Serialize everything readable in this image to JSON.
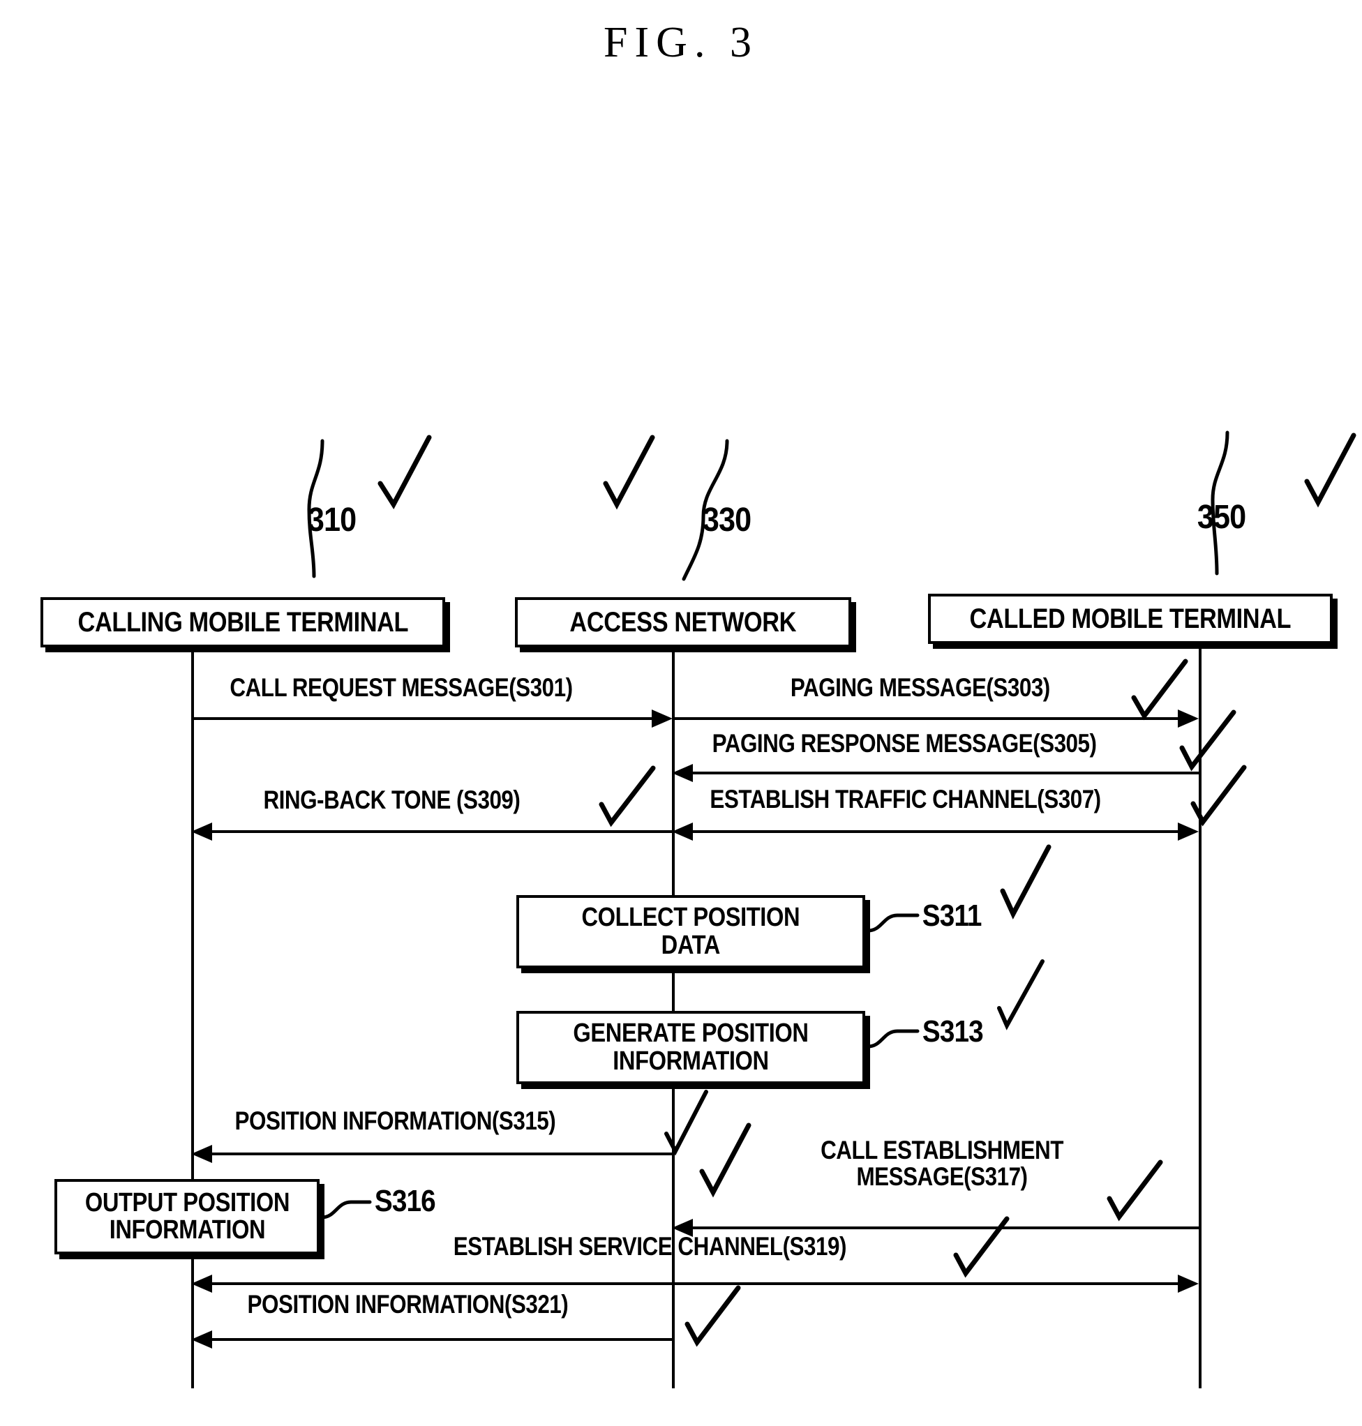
{
  "figure": {
    "title": "FIG. 3",
    "type": "patent-sequence-diagram"
  },
  "entities": [
    {
      "id": "calling",
      "label": "CALLING MOBILE TERMINAL",
      "ref": "310"
    },
    {
      "id": "access",
      "label": "ACCESS NETWORK",
      "ref": "330"
    },
    {
      "id": "called",
      "label": "CALLED MOBILE TERMINAL",
      "ref": "350"
    }
  ],
  "messages": [
    {
      "step": "S301",
      "label": "CALL REQUEST MESSAGE(S301)",
      "from": "calling",
      "to": "access",
      "direction": "right"
    },
    {
      "step": "S303",
      "label": "PAGING MESSAGE(S303)",
      "from": "access",
      "to": "called",
      "direction": "right"
    },
    {
      "step": "S305",
      "label": "PAGING RESPONSE MESSAGE(S305)",
      "from": "called",
      "to": "access",
      "direction": "left"
    },
    {
      "step": "S307",
      "label": "ESTABLISH TRAFFIC CHANNEL(S307)",
      "from": "access",
      "to": "called",
      "direction": "both"
    },
    {
      "step": "S309",
      "label": "RING-BACK TONE (S309)",
      "from": "access",
      "to": "calling",
      "direction": "left"
    },
    {
      "step": "S315",
      "label": "POSITION INFORMATION(S315)",
      "from": "access",
      "to": "calling",
      "direction": "left"
    },
    {
      "step": "S317",
      "label": "CALL ESTABLISHMENT MESSAGE(S317)",
      "from": "called",
      "to": "access",
      "direction": "left"
    },
    {
      "step": "S319",
      "label": "ESTABLISH SERVICE CHANNEL(S319)",
      "from": "calling",
      "to": "called",
      "direction": "both"
    },
    {
      "step": "S321",
      "label": "POSITION INFORMATION(S321)",
      "from": "access",
      "to": "calling",
      "direction": "left"
    }
  ],
  "message_labels": {
    "s301": "CALL REQUEST MESSAGE(S301)",
    "s303": "PAGING MESSAGE(S303)",
    "s305": "PAGING RESPONSE MESSAGE(S305)",
    "s307": "ESTABLISH TRAFFIC CHANNEL(S307)",
    "s309": "RING-BACK TONE (S309)",
    "s315": "POSITION INFORMATION(S315)",
    "s317_line1": "CALL ESTABLISHMENT",
    "s317_line2": "MESSAGE(S317)",
    "s319": "ESTABLISH SERVICE CHANNEL(S319)",
    "s321": "POSITION INFORMATION(S321)"
  },
  "processes": [
    {
      "id": "collect",
      "line1": "COLLECT POSITION",
      "line2": "DATA",
      "ref": "S311",
      "lane": "access"
    },
    {
      "id": "generate",
      "line1": "GENERATE POSITION",
      "line2": "INFORMATION",
      "ref": "S313",
      "lane": "access"
    },
    {
      "id": "output",
      "line1": "OUTPUT POSITION",
      "line2": "INFORMATION",
      "ref": "S316",
      "lane": "calling"
    }
  ],
  "process_labels": {
    "collect_line1": "COLLECT POSITION",
    "collect_line2": "DATA",
    "collect_ref": "S311",
    "generate_line1": "GENERATE POSITION",
    "generate_line2": "INFORMATION",
    "generate_ref": "S313",
    "output_line1": "OUTPUT POSITION",
    "output_line2": "INFORMATION",
    "output_ref": "S316"
  },
  "entity_labels": {
    "calling": "CALLING MOBILE TERMINAL",
    "access": "ACCESS NETWORK",
    "called": "CALLED MOBILE TERMINAL",
    "calling_ref": "310",
    "access_ref": "330",
    "called_ref": "350"
  },
  "colors": {
    "ink": "#000000",
    "background": "#ffffff"
  }
}
